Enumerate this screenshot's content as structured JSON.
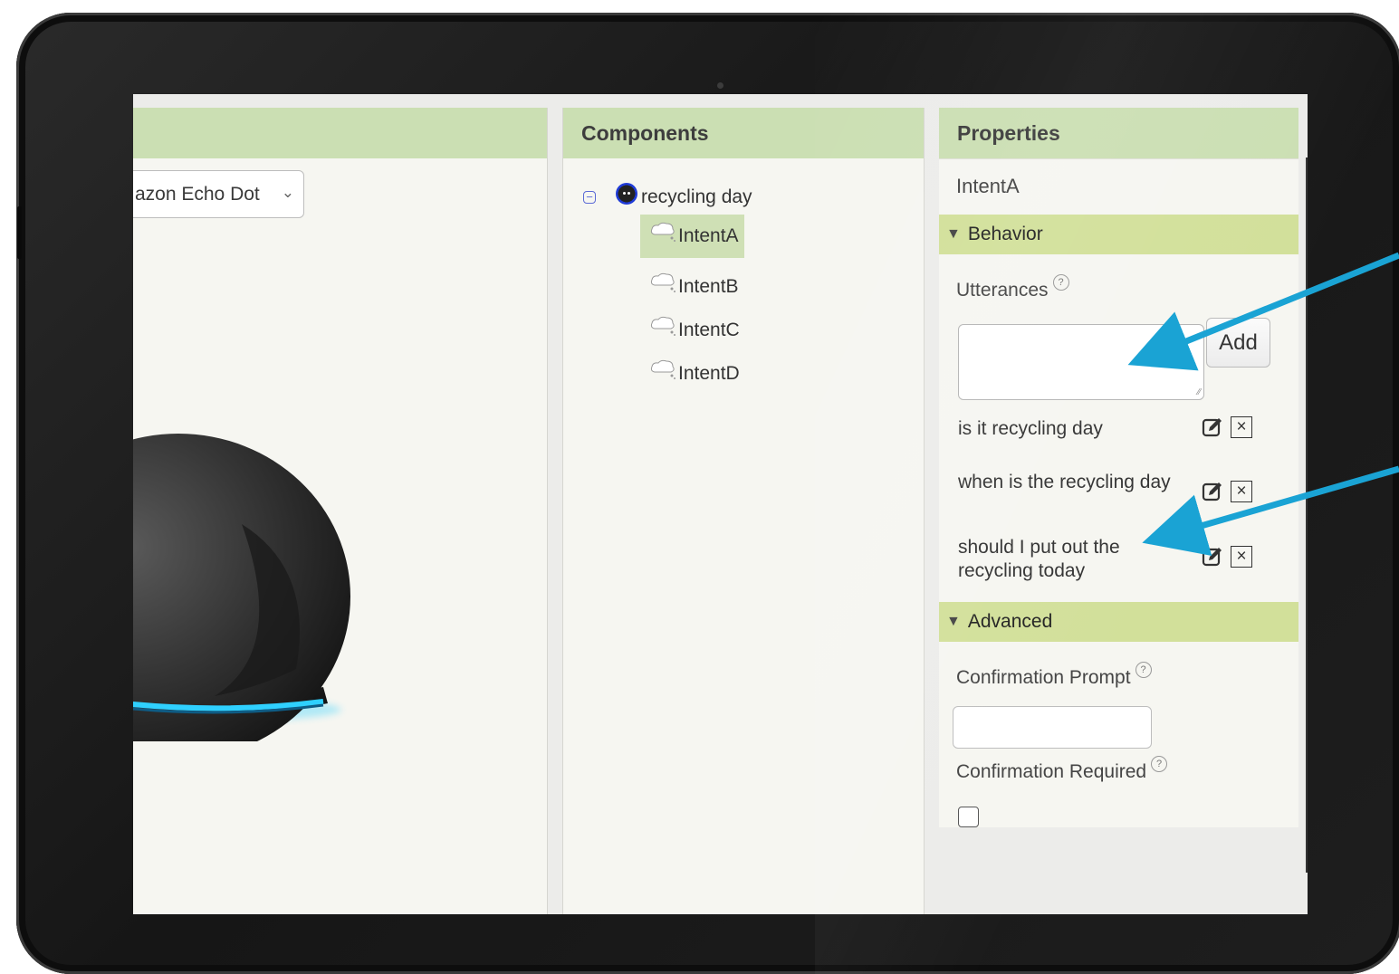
{
  "viewer": {
    "device_select_value": "azon Echo Dot"
  },
  "components": {
    "title": "Components",
    "root_label": "recycling day",
    "items": [
      {
        "label": "IntentA",
        "selected": true
      },
      {
        "label": "IntentB",
        "selected": false
      },
      {
        "label": "IntentC",
        "selected": false
      },
      {
        "label": "IntentD",
        "selected": false
      }
    ]
  },
  "properties": {
    "title": "Properties",
    "selected_component": "IntentA",
    "behavior_label": "Behavior",
    "utterances_label": "Utterances",
    "utterance_input_value": "",
    "add_label": "Add",
    "utterances": [
      "is it recycling day",
      "when is the recycling day",
      "should I put out the recycling today"
    ],
    "advanced_label": "Advanced",
    "confirmation_prompt_label": "Confirmation Prompt",
    "confirmation_prompt_value": "",
    "confirmation_required_label": "Confirmation Required",
    "confirmation_required_checked": false
  },
  "colors": {
    "panel_header": "#cbdfb3",
    "section_bar": "#d2e09a",
    "selected_item": "#cfe0b5",
    "annotation_arrow": "#1aa3d4",
    "echo_ring": "#2fd0ff"
  },
  "icons": {
    "collapse": "collapse-minus-icon",
    "root": "robot-icon",
    "intent": "thought-cloud-icon",
    "edit": "edit-icon",
    "delete": "close-box-icon",
    "help": "help-icon"
  }
}
